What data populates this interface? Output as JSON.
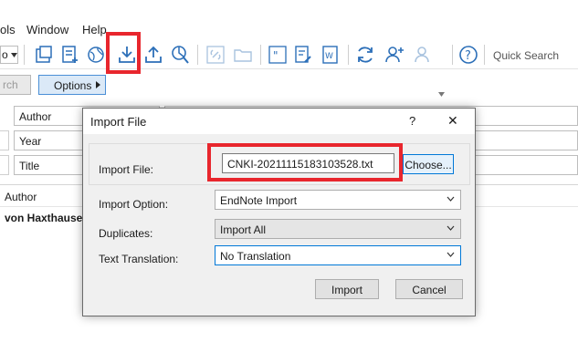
{
  "menu": {
    "tools": "ols",
    "window": "Window",
    "help": "Help"
  },
  "toolbar": {
    "quick_search": "Quick Search",
    "style_value": "o"
  },
  "search": {
    "search_label": "rch",
    "options_label": "Options"
  },
  "fields": {
    "author": "Author",
    "year": "Year",
    "title": "Title"
  },
  "library": {
    "author_header": "Author",
    "first_author": "von Haxthausen"
  },
  "dialog": {
    "title": "Import File",
    "help": "?",
    "close": "✕",
    "import_file_label": "Import File:",
    "import_file_value": "CNKI-20211115183103528.txt",
    "choose_label": "Choose...",
    "import_option_label": "Import Option:",
    "import_option_value": "EndNote Import",
    "duplicates_label": "Duplicates:",
    "duplicates_value": "Import All",
    "translation_label": "Text Translation:",
    "translation_value": "No Translation",
    "import_button": "Import",
    "cancel_button": "Cancel"
  },
  "colors": {
    "highlight": "#e8262d",
    "accent": "#0078d7",
    "icon_blue": "#2c6fb8"
  }
}
